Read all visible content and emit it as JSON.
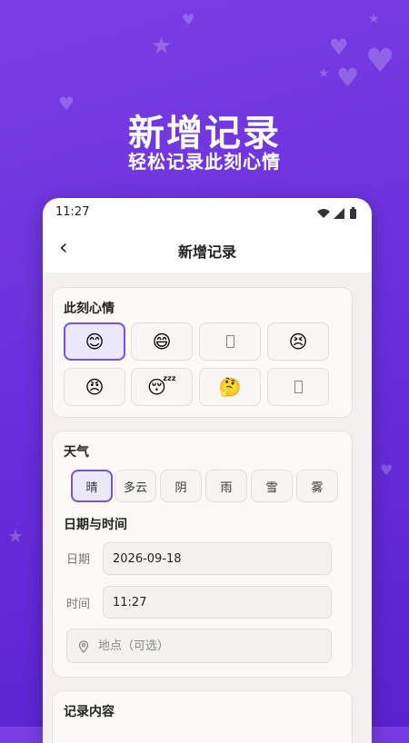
{
  "hero": {
    "title": "新增记录",
    "subtitle": "轻松记录此刻心情"
  },
  "status_bar": {
    "time": "11:27"
  },
  "app_bar": {
    "title": "新增记录"
  },
  "mood_section": {
    "title": "此刻心情",
    "options": [
      {
        "emoji": "😊",
        "selected": true
      },
      {
        "emoji": "😄",
        "selected": false
      },
      {
        "emoji": "",
        "selected": false
      },
      {
        "emoji": "😣",
        "selected": false
      },
      {
        "emoji": "😠",
        "selected": false
      },
      {
        "emoji": "😴",
        "selected": false
      },
      {
        "emoji": "🤔",
        "selected": false
      },
      {
        "emoji": "",
        "selected": false
      }
    ]
  },
  "weather_section": {
    "title": "天气",
    "options": [
      {
        "label": "晴",
        "selected": true
      },
      {
        "label": "多云",
        "selected": false
      },
      {
        "label": "阴",
        "selected": false
      },
      {
        "label": "雨",
        "selected": false
      },
      {
        "label": "雪",
        "selected": false
      },
      {
        "label": "雾",
        "selected": false
      }
    ]
  },
  "datetime_section": {
    "title": "日期与时间",
    "date_label": "日期",
    "date_value": "2026-09-18",
    "time_label": "时间",
    "time_value": "11:27",
    "location_placeholder": "地点（可选）"
  },
  "content_section": {
    "title": "记录内容"
  },
  "colors": {
    "accent": "#7a52d6",
    "background": "#6a30dc"
  }
}
